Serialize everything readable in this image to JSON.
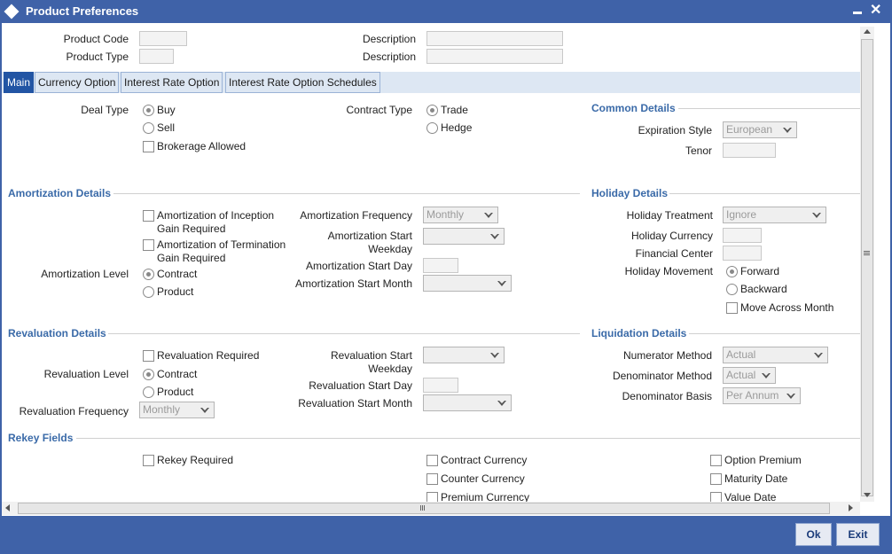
{
  "window": {
    "title": "Product Preferences"
  },
  "header": {
    "product_code_label": "Product Code",
    "product_type_label": "Product Type",
    "description1_label": "Description",
    "description2_label": "Description"
  },
  "tabs": [
    {
      "label": "Main",
      "active": true
    },
    {
      "label": "Currency Option"
    },
    {
      "label": "Interest Rate Option"
    },
    {
      "label": "Interest Rate Option Schedules"
    }
  ],
  "main": {
    "deal_type_label": "Deal Type",
    "buy": "Buy",
    "sell": "Sell",
    "brokerage": "Brokerage Allowed",
    "contract_type_label": "Contract Type",
    "trade": "Trade",
    "hedge": "Hedge"
  },
  "common": {
    "title": "Common Details",
    "expiration_label": "Expiration Style",
    "expiration_value": "European",
    "tenor_label": "Tenor"
  },
  "amort": {
    "title": "Amortization Details",
    "inception": "Amortization of Inception",
    "inception2": "Gain Required",
    "termination": "Amortization of Termination",
    "termination2": "Gain Required",
    "level_label": "Amortization Level",
    "contract": "Contract",
    "product": "Product",
    "freq_label": "Amortization Frequency",
    "freq_value": "Monthly",
    "start_weekday_label": "Amortization Start",
    "start_weekday_label2": "Weekday",
    "start_day_label": "Amortization Start Day",
    "start_month_label": "Amortization Start Month"
  },
  "holiday": {
    "title": "Holiday Details",
    "treatment_label": "Holiday Treatment",
    "treatment_value": "Ignore",
    "currency_label": "Holiday Currency",
    "center_label": "Financial Center",
    "movement_label": "Holiday Movement",
    "forward": "Forward",
    "backward": "Backward",
    "move_across": "Move Across Month"
  },
  "reval": {
    "title": "Revaluation Details",
    "required": "Revaluation Required",
    "level_label": "Revaluation Level",
    "contract": "Contract",
    "product": "Product",
    "freq_label": "Revaluation Frequency",
    "freq_value": "Monthly",
    "start_weekday_label": "Revaluation Start",
    "start_weekday_label2": "Weekday",
    "start_day_label": "Revaluation Start Day",
    "start_month_label": "Revaluation Start Month"
  },
  "liquidation": {
    "title": "Liquidation Details",
    "numerator_label": "Numerator Method",
    "numerator_value": "Actual",
    "denominator_label": "Denominator Method",
    "denominator_value": "Actual",
    "basis_label": "Denominator Basis",
    "basis_value": "Per Annum"
  },
  "rekey": {
    "title": "Rekey Fields",
    "required": "Rekey Required",
    "contract_currency": "Contract Currency",
    "counter_currency": "Counter Currency",
    "premium_currency": "Premium Currency",
    "option_premium": "Option Premium",
    "maturity_date": "Maturity Date",
    "value_date": "Value Date"
  },
  "footer": {
    "ok": "Ok",
    "exit": "Exit"
  },
  "colors": {
    "titlebar": "#3f62a8",
    "section_title": "#3a6aa8",
    "active_tab": "#2255a4"
  }
}
